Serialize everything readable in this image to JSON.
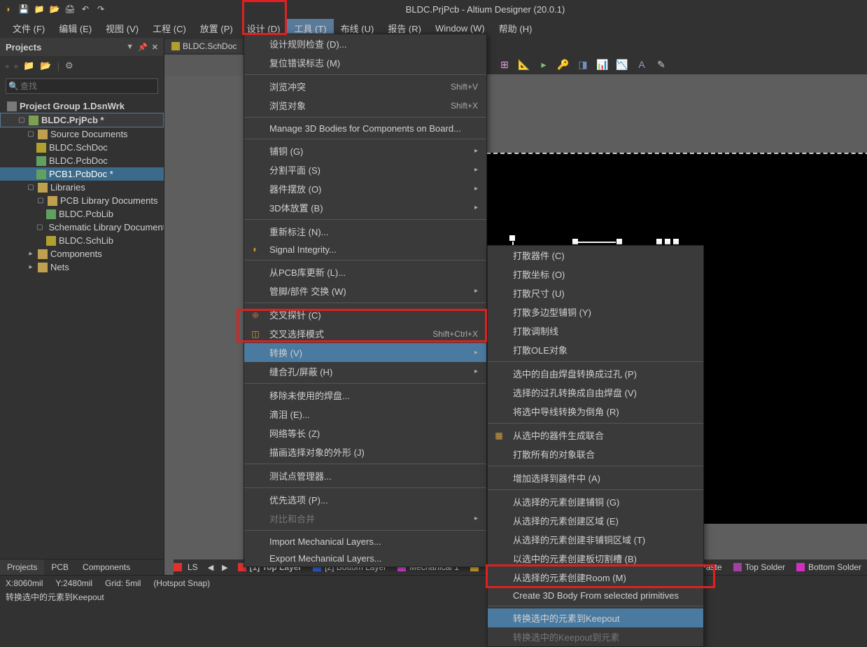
{
  "title": "BLDC.PrjPcb - Altium Designer (20.0.1)",
  "menubar": {
    "file": "文件 (F)",
    "edit": "编辑 (E)",
    "view": "视图 (V)",
    "project": "工程 (C)",
    "place": "放置 (P)",
    "design": "设计 (D)",
    "tools": "工具 (T)",
    "route": "布线 (U)",
    "report": "报告 (R)",
    "window": "Window (W)",
    "help": "帮助 (H)"
  },
  "projects_panel": {
    "title": "Projects",
    "search_placeholder": "查找",
    "tree": {
      "group": "Project Group 1.DsnWrk",
      "prj": "BLDC.PrjPcb *",
      "src_docs": "Source Documents",
      "sch": "BLDC.SchDoc",
      "pcb": "BLDC.PcbDoc",
      "pcb1": "PCB1.PcbDoc *",
      "libs": "Libraries",
      "pcblib_docs": "PCB Library Documents",
      "pcblib": "BLDC.PcbLib",
      "schlib_docs": "Schematic Library Documents",
      "schlib": "BLDC.SchLib",
      "components": "Components",
      "nets": "Nets"
    },
    "tabs": {
      "projects": "Projects",
      "pcb": "PCB",
      "components": "Components"
    }
  },
  "doc_tab": "BLDC.SchDoc",
  "tools_menu": {
    "drc": "设计规则检查 (D)...",
    "reset_err": "复位错误标志 (M)",
    "browse_viol": "浏览冲突",
    "browse_viol_sc": "Shift+V",
    "browse_obj": "浏览对象",
    "browse_obj_sc": "Shift+X",
    "m3d": "Manage 3D Bodies for Components on Board...",
    "poly": "铺铜 (G)",
    "split": "分割平面 (S)",
    "comp_place": "器件摆放 (O)",
    "body3d": "3D体放置 (B)",
    "reanno": "重新标注 (N)...",
    "si": "Signal Integrity...",
    "upd_pcb": "从PCB库更新 (L)...",
    "pin_swap": "管脚/部件 交换 (W)",
    "xprobe": "交叉探针 (C)",
    "xselect": "交叉选择模式",
    "xselect_sc": "Shift+Ctrl+X",
    "convert": "转换 (V)",
    "stitch": "缝合孔/屏蔽 (H)",
    "remove_unused": "移除未使用的焊盘...",
    "td": "滴泪 (E)...",
    "net_eq": "网络等长 (Z)",
    "outline_sel": "描画选择对象的外形 (J)",
    "tp_mgr": "测试点管理器...",
    "pref": "优先选项 (P)...",
    "compare": "对比和合并",
    "import_mech": "Import Mechanical Layers...",
    "export_mech": "Export Mechanical Layers..."
  },
  "convert_submenu": {
    "explode_comp": "打散器件 (C)",
    "explode_coord": "打散坐标 (O)",
    "explode_dim": "打散尺寸 (U)",
    "explode_poly": "打散多边型铺铜 (Y)",
    "explode_tune": "打散调制线",
    "explode_ole": "打散OLE对象",
    "free_to_via": "选中的自由焊盘转换成过孔 (P)",
    "via_to_free": "选择的过孔转换成自由焊盘 (V)",
    "track_to_arc": "将选中导线转换为倒角 (R)",
    "union_sel": "从选中的器件生成联合",
    "union_all": "打散所有的对象联合",
    "add_sel_comp": "增加选择到器件中 (A)",
    "create_poly": "从选择的元素创建铺铜 (G)",
    "create_region": "从选择的元素创建区域 (E)",
    "create_npoly": "从选择的元素创建非铺铜区域 (T)",
    "create_cutout": "以选中的元素创建板切割槽 (B)",
    "create_room": "从选择的元素创建Room (M)",
    "create_3d": "Create 3D Body From selected primitives",
    "to_keepout": "转换选中的元素到Keepout",
    "to_prim": "转换选中的Keepout到元素"
  },
  "layers": {
    "ls": "LS",
    "top": "[1] Top Layer",
    "bottom": "[2] Bottom Layer",
    "mech": "Mechanical 1",
    "bpaste": "Bottom Paste",
    "tsolder": "Top Solder",
    "bsolder": "Bottom Solder"
  },
  "status": {
    "pos_x": "X:8060mil",
    "pos_y": "Y:2480mil",
    "grid": "Grid: 5mil",
    "snap": "(Hotspot Snap)",
    "hint": "转换选中的元素到Keepout"
  }
}
